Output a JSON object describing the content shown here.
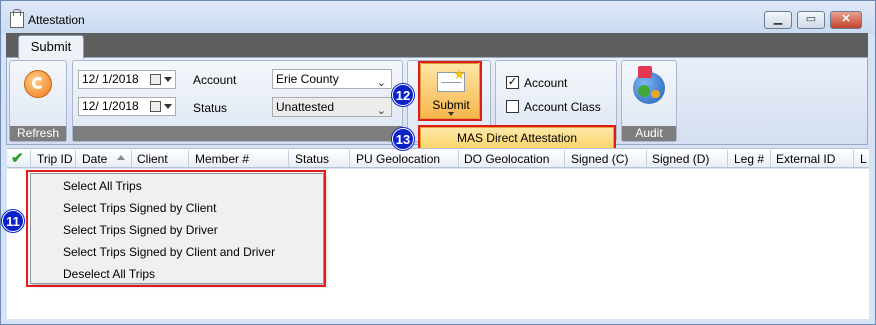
{
  "window": {
    "title": "Attestation",
    "minimize": "▁",
    "maximize": "▭",
    "close": "✕"
  },
  "ribbon": {
    "tab": "Submit",
    "refresh": {
      "label": "Refresh"
    },
    "filters": {
      "date_from": "12/  1/2018",
      "date_to": "12/  1/2018",
      "account_label": "Account",
      "account_value": "Erie County",
      "status_label": "Status",
      "status_value": "Unattested"
    },
    "submit": {
      "label": "Submit",
      "menu_item": "MAS Direct Attestation"
    },
    "options": {
      "account": "Account",
      "account_class": "Account Class",
      "account_checked": true,
      "account_class_checked": false
    },
    "audit": {
      "label": "Audit"
    }
  },
  "grid": {
    "columns": [
      "Trip ID",
      "Date",
      "Client",
      "Member #",
      "Status",
      "PU Geolocation",
      "DO Geolocation",
      "Signed (C)",
      "Signed (D)",
      "Leg #",
      "External ID",
      "L"
    ]
  },
  "context_menu": {
    "items": [
      "Select All Trips",
      "Select Trips Signed by Client",
      "Select Trips Signed by Driver",
      "Select Trips Signed by Client and Driver",
      "Deselect All Trips"
    ]
  },
  "annotations": {
    "badge_11": "11",
    "badge_12": "12",
    "badge_13": "13"
  },
  "colors": {
    "highlight": "#e01b1b",
    "badge": "#0b22c9",
    "menu_hover": "#fbd46a"
  }
}
